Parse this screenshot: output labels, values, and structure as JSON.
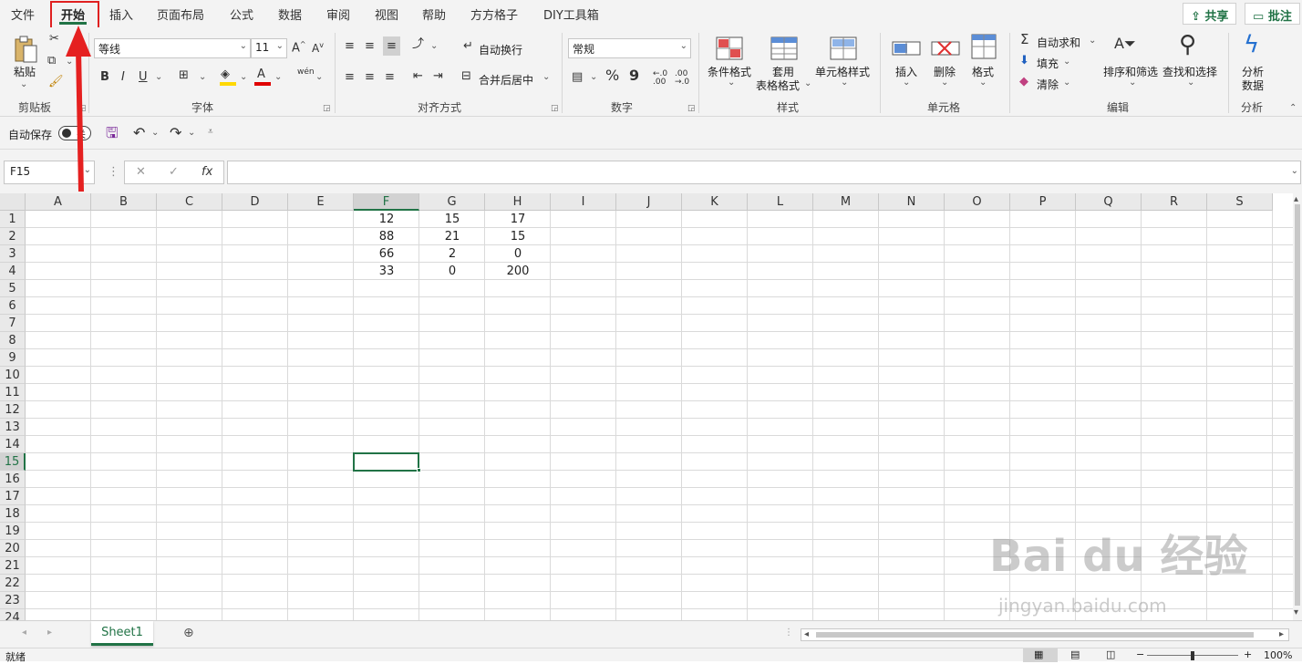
{
  "tabs": [
    "文件",
    "开始",
    "插入",
    "页面布局",
    "公式",
    "数据",
    "审阅",
    "视图",
    "帮助",
    "方方格子",
    "DIY工具箱"
  ],
  "top_buttons": {
    "share": "共享",
    "comment": "批注"
  },
  "ribbon": {
    "clipboard": {
      "paste": "粘贴",
      "group": "剪贴板"
    },
    "font": {
      "name": "等线",
      "size": "11",
      "group": "字体",
      "bold": "B",
      "italic": "I",
      "underline": "U",
      "grow": "A",
      "shrink": "A",
      "phonetic": "wén",
      "color_a": "A"
    },
    "alignment": {
      "wrap": "自动换行",
      "merge": "合并后居中",
      "group": "对齐方式"
    },
    "number": {
      "format": "常规",
      "percent": "%",
      "comma": "9",
      "group": "数字"
    },
    "styles": {
      "conditional": "条件格式",
      "table_format_1": "套用",
      "table_format_2": "表格格式",
      "cell_styles": "单元格样式",
      "group": "样式"
    },
    "cells": {
      "insert": "插入",
      "delete": "删除",
      "format": "格式",
      "group": "单元格"
    },
    "editing": {
      "autosum": "自动求和",
      "fill": "填充",
      "clear": "清除",
      "sort": "排序和筛选",
      "find": "查找和选择",
      "group": "编辑"
    },
    "analysis": {
      "analyze_1": "分析",
      "analyze_2": "数据",
      "group": "分析"
    }
  },
  "qat": {
    "autosave": "自动保存",
    "toggle_state": "关"
  },
  "formula_bar": {
    "name_box": "F15",
    "content": ""
  },
  "columns": [
    "A",
    "B",
    "C",
    "D",
    "E",
    "F",
    "G",
    "H",
    "I",
    "J",
    "K",
    "L",
    "M",
    "N",
    "O",
    "P",
    "Q",
    "R",
    "S"
  ],
  "rows": [
    "1",
    "2",
    "3",
    "4",
    "5",
    "6",
    "7",
    "8",
    "9",
    "10",
    "11",
    "12",
    "13",
    "14",
    "15",
    "16",
    "17",
    "18",
    "19",
    "20",
    "21",
    "22",
    "23",
    "24"
  ],
  "cells": [
    {
      "col": "F",
      "row": 1,
      "v": "12"
    },
    {
      "col": "G",
      "row": 1,
      "v": "15"
    },
    {
      "col": "H",
      "row": 1,
      "v": "17"
    },
    {
      "col": "F",
      "row": 2,
      "v": "88"
    },
    {
      "col": "G",
      "row": 2,
      "v": "21"
    },
    {
      "col": "H",
      "row": 2,
      "v": "15"
    },
    {
      "col": "F",
      "row": 3,
      "v": "66"
    },
    {
      "col": "G",
      "row": 3,
      "v": "2"
    },
    {
      "col": "H",
      "row": 3,
      "v": "0"
    },
    {
      "col": "F",
      "row": 4,
      "v": "33"
    },
    {
      "col": "G",
      "row": 4,
      "v": "0"
    },
    {
      "col": "H",
      "row": 4,
      "v": "200"
    }
  ],
  "selected": {
    "col": "F",
    "row": 15
  },
  "sheet_tab": "Sheet1",
  "status": {
    "ready": "就绪",
    "zoom": "100%"
  },
  "watermark": {
    "main": "Bai du 经验",
    "sub": "jingyan.baidu.com"
  },
  "colors": {
    "accent": "#217346",
    "highlight": "#e02020"
  }
}
